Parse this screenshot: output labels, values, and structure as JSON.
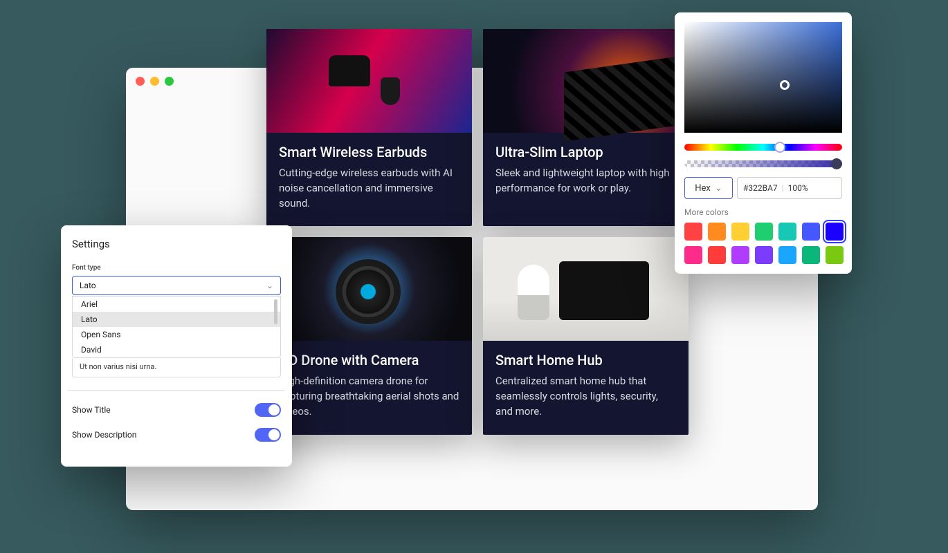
{
  "browser": {
    "dots": [
      "red",
      "yellow",
      "green"
    ]
  },
  "cards": [
    {
      "title": "Smart Wireless Earbuds",
      "desc": "Cutting-edge wireless earbuds with AI noise cancellation and immersive sound."
    },
    {
      "title": "Ultra-Slim Laptop",
      "desc": "Sleek and lightweight laptop with high performance for work or play."
    },
    {
      "title": "HD Drone with Camera",
      "desc": "High-definition camera drone for capturing breathtaking aerial shots and videos."
    },
    {
      "title": "Smart Home Hub",
      "desc": "Centralized smart home hub that seamlessly controls lights, security, and more."
    }
  ],
  "settings": {
    "heading": "Settings",
    "font_type_label": "Font type",
    "font_selected": "Lato",
    "font_options": [
      "Ariel",
      "Lato",
      "Open Sans",
      "David"
    ],
    "textarea_value": "Ut non varius nisi urna.",
    "show_title_label": "Show Title",
    "show_title": true,
    "show_desc_label": "Show Description",
    "show_desc": true
  },
  "color_picker": {
    "format_label": "Hex",
    "hex_value": "#322BA7",
    "alpha_value": "100%",
    "more_colors_label": "More colors",
    "swatches": [
      "#ff4242",
      "#ff8a1f",
      "#ffcf33",
      "#1fcf6f",
      "#17c9b4",
      "#4557ff",
      "#1900ff",
      "#ff2b8b",
      "#ff3b3b",
      "#b03cff",
      "#7c3cff",
      "#1aa6ff",
      "#0bb67a",
      "#7ac80f"
    ],
    "active_swatch_index": 6
  }
}
